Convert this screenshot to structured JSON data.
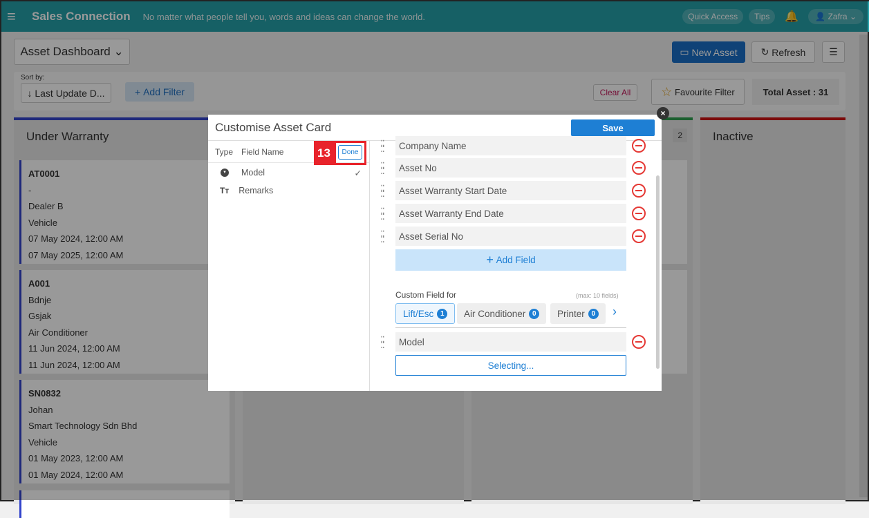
{
  "header": {
    "brand": "Sales Connection",
    "tagline": "No matter what people tell you, words and ideas can change the world.",
    "quick_access": "Quick Access",
    "tips": "Tips",
    "user": "Zafra"
  },
  "toolbar": {
    "dashboard": "Asset Dashboard",
    "new_asset": "New Asset",
    "refresh": "Refresh",
    "sort_label": "Sort by:",
    "sort_value": "Last Update D...",
    "add_filter": "Add Filter",
    "clear_all": "Clear All",
    "favourite_filter": "Favourite Filter",
    "total": "Total Asset : 31"
  },
  "columns": [
    {
      "title": "Under Warranty",
      "color": "#3344cc"
    },
    {
      "title": "",
      "color": "#3344cc"
    },
    {
      "title": "",
      "count": "2",
      "color": "#2e9e4f"
    },
    {
      "title": "Inactive",
      "color": "#cc1111"
    }
  ],
  "cards": [
    {
      "lines": [
        "AT0001",
        "-",
        "Dealer B",
        "Vehicle",
        "07 May 2024, 12:00 AM",
        "07 May 2025, 12:00 AM"
      ]
    },
    {
      "lines": [
        "A001",
        "Bdnje",
        "Gsjak",
        "Air Conditioner",
        "11 Jun 2024, 12:00 AM",
        "11 Jun 2024, 12:00 AM"
      ]
    },
    {
      "lines": [
        "SN0832",
        "Johan",
        "Smart Technology Sdn Bhd",
        "Vehicle",
        "01 May 2023, 12:00 AM",
        "01 May 2024, 12:00 AM"
      ]
    }
  ],
  "modal": {
    "title": "Customise Asset Card",
    "save": "Save",
    "col_type": "Type",
    "col_field": "Field Name",
    "done": "Done",
    "step": "13",
    "available": [
      {
        "icon": "dropdown-icon",
        "name": "Model",
        "checked": true
      },
      {
        "icon": "text-icon",
        "name": "Remarks",
        "checked": false
      }
    ],
    "fields": [
      "Company Name",
      "Asset No",
      "Asset Warranty Start Date",
      "Asset Warranty End Date",
      "Asset Serial No"
    ],
    "add_field": "Add Field",
    "custom_label": "Custom Field for",
    "max_note": "(max: 10 fields)",
    "tabs": [
      {
        "label": "Lift/Esc",
        "count": "1"
      },
      {
        "label": "Air Conditioner",
        "count": "0"
      },
      {
        "label": "Printer",
        "count": "0"
      }
    ],
    "custom_fields": [
      "Model"
    ],
    "selecting": "Selecting..."
  }
}
